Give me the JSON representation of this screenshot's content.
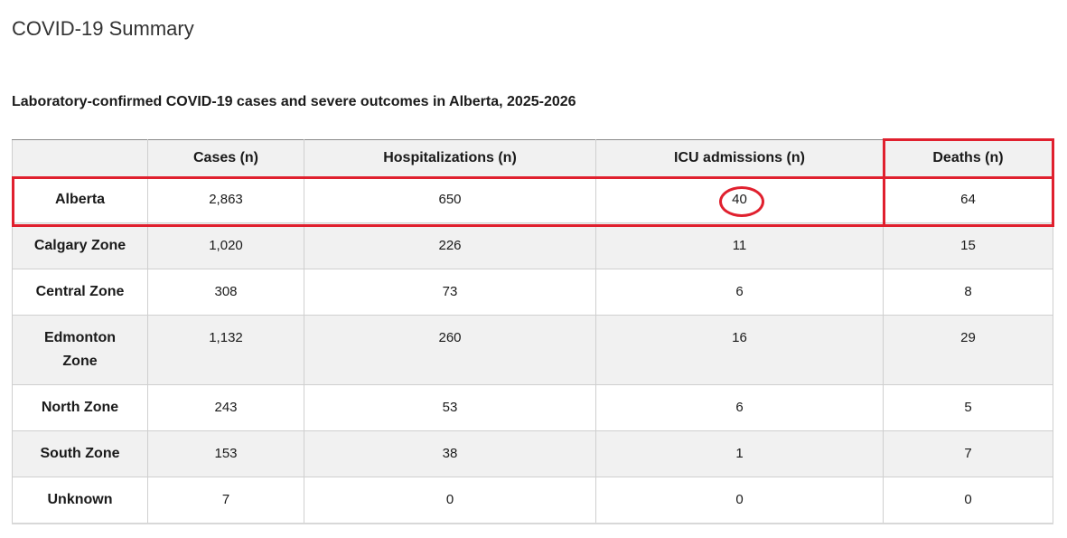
{
  "page": {
    "title": "COVID-19 Summary",
    "caption": "Laboratory-confirmed COVID-19 cases and severe outcomes in Alberta, 2025-2026"
  },
  "table": {
    "headers": [
      "",
      "Cases (n)",
      "Hospitalizations (n)",
      "ICU admissions (n)",
      "Deaths (n)"
    ],
    "rows": [
      {
        "region": "Alberta",
        "cases": "2,863",
        "hospitalizations": "650",
        "icu": "40",
        "deaths": "64"
      },
      {
        "region": "Calgary Zone",
        "cases": "1,020",
        "hospitalizations": "226",
        "icu": "11",
        "deaths": "15"
      },
      {
        "region": "Central Zone",
        "cases": "308",
        "hospitalizations": "73",
        "icu": "6",
        "deaths": "8"
      },
      {
        "region": "Edmonton Zone",
        "cases": "1,132",
        "hospitalizations": "260",
        "icu": "16",
        "deaths": "29"
      },
      {
        "region": "North Zone",
        "cases": "243",
        "hospitalizations": "53",
        "icu": "6",
        "deaths": "5"
      },
      {
        "region": "South Zone",
        "cases": "153",
        "hospitalizations": "38",
        "icu": "1",
        "deaths": "7"
      },
      {
        "region": "Unknown",
        "cases": "7",
        "hospitalizations": "0",
        "icu": "0",
        "deaths": "0"
      }
    ]
  },
  "annotations": {
    "color": "#e0202e"
  }
}
